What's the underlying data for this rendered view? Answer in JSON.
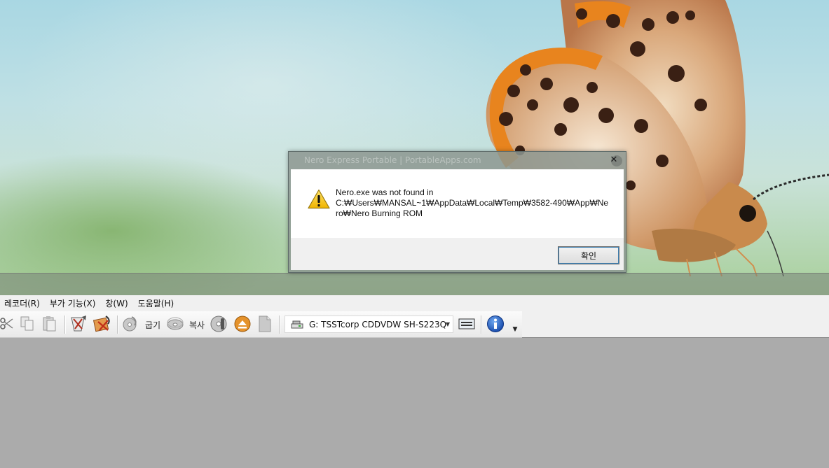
{
  "dialog": {
    "title": "Nero Express Portable | PortableApps.com",
    "message_line1": "Nero.exe was not found in",
    "message_path": "C:₩Users₩MANSAL~1₩AppData₩Local₩Temp₩3582-490₩App₩Nero₩Nero Burning ROM",
    "ok_label": "확인",
    "icon": "warning-icon"
  },
  "menubar": {
    "items": [
      {
        "label": "레코더(R)"
      },
      {
        "label": "부가 기능(X)"
      },
      {
        "label": "창(W)"
      },
      {
        "label": "도움말(H)"
      }
    ]
  },
  "toolbar": {
    "burn_label": "굽기",
    "copy_label": "복사",
    "drive_selected": "G: TSSTcorp CDDVDW SH-S223Q",
    "icons": [
      "cut-icon",
      "copy-icon",
      "paste-icon",
      "erase-disc-icon",
      "burn-compilation-icon",
      "burn-icon",
      "copy-disc-icon",
      "disc-info-icon",
      "eject-icon",
      "blank-page-icon",
      "drive-icon",
      "drive-options-icon",
      "info-icon"
    ]
  },
  "colors": {
    "accent": "#3c7fb1",
    "workspace": "#ababab",
    "warning": "#f5c518"
  }
}
